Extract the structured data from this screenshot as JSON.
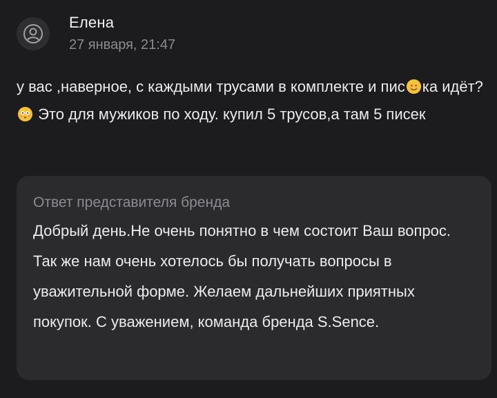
{
  "review": {
    "author": "Елена",
    "date": "27 января, 21:47",
    "text_part1": "у вас ,наверное, с каждыми трусами в комплекте и пис",
    "emoji1": "smiling-face-emoji",
    "text_part2": "ка идёт?",
    "emoji2": "flushed-face-emoji",
    "text_part3": " Это для мужиков по ходу. купил 5 трусов,а там 5 писек"
  },
  "brand_reply": {
    "title": "Ответ представителя бренда",
    "text": "Добрый день.Не очень понятно в чем состоит Ваш вопрос. Так же нам очень хотелось бы получать вопросы в уважительной форме. Желаем дальнейших приятных покупок. С уважением, команда бренда S.Sence."
  },
  "colors": {
    "background": "#1c1c1e",
    "card": "#2b2b2e",
    "muted_text": "#8b8b90",
    "emoji_yellow": "#f7c23a"
  }
}
